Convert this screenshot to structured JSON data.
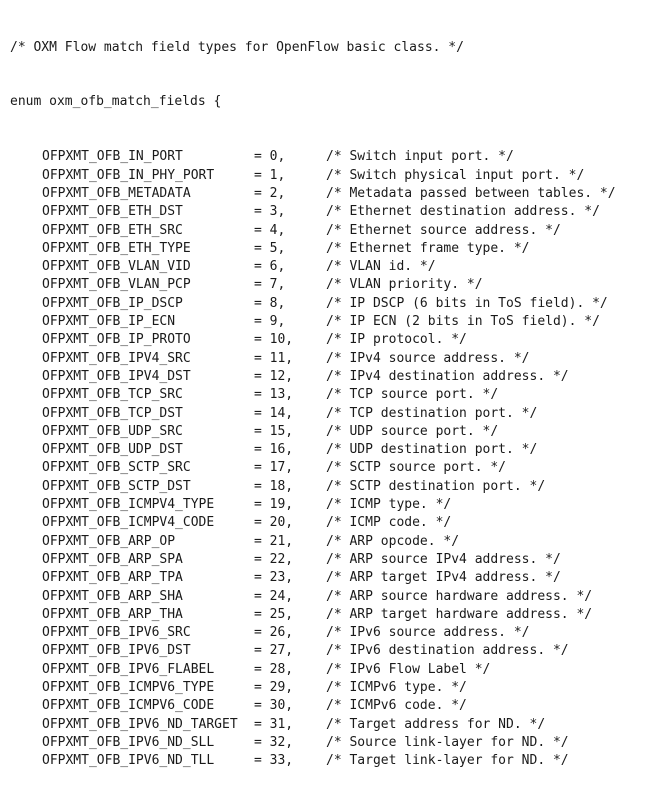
{
  "header_comment": "/* OXM Flow match field types for OpenFlow basic class. */",
  "enum_decl": "enum oxm_ofb_match_fields {",
  "entries": [
    {
      "name": "OFPXMT_OFB_IN_PORT",
      "value": "= 0,",
      "comment": "/* Switch input port. */"
    },
    {
      "name": "OFPXMT_OFB_IN_PHY_PORT",
      "value": "= 1,",
      "comment": "/* Switch physical input port. */"
    },
    {
      "name": "OFPXMT_OFB_METADATA",
      "value": "= 2,",
      "comment": "/* Metadata passed between tables. */"
    },
    {
      "name": "OFPXMT_OFB_ETH_DST",
      "value": "= 3,",
      "comment": "/* Ethernet destination address. */"
    },
    {
      "name": "OFPXMT_OFB_ETH_SRC",
      "value": "= 4,",
      "comment": "/* Ethernet source address. */"
    },
    {
      "name": "OFPXMT_OFB_ETH_TYPE",
      "value": "= 5,",
      "comment": "/* Ethernet frame type. */"
    },
    {
      "name": "OFPXMT_OFB_VLAN_VID",
      "value": "= 6,",
      "comment": "/* VLAN id. */"
    },
    {
      "name": "OFPXMT_OFB_VLAN_PCP",
      "value": "= 7,",
      "comment": "/* VLAN priority. */"
    },
    {
      "name": "OFPXMT_OFB_IP_DSCP",
      "value": "= 8,",
      "comment": "/* IP DSCP (6 bits in ToS field). */"
    },
    {
      "name": "OFPXMT_OFB_IP_ECN",
      "value": "= 9,",
      "comment": "/* IP ECN (2 bits in ToS field). */"
    },
    {
      "name": "OFPXMT_OFB_IP_PROTO",
      "value": "= 10,",
      "comment": "/* IP protocol. */"
    },
    {
      "name": "OFPXMT_OFB_IPV4_SRC",
      "value": "= 11,",
      "comment": "/* IPv4 source address. */"
    },
    {
      "name": "OFPXMT_OFB_IPV4_DST",
      "value": "= 12,",
      "comment": "/* IPv4 destination address. */"
    },
    {
      "name": "OFPXMT_OFB_TCP_SRC",
      "value": "= 13,",
      "comment": "/* TCP source port. */"
    },
    {
      "name": "OFPXMT_OFB_TCP_DST",
      "value": "= 14,",
      "comment": "/* TCP destination port. */"
    },
    {
      "name": "OFPXMT_OFB_UDP_SRC",
      "value": "= 15,",
      "comment": "/* UDP source port. */"
    },
    {
      "name": "OFPXMT_OFB_UDP_DST",
      "value": "= 16,",
      "comment": "/* UDP destination port. */"
    },
    {
      "name": "OFPXMT_OFB_SCTP_SRC",
      "value": "= 17,",
      "comment": "/* SCTP source port. */"
    },
    {
      "name": "OFPXMT_OFB_SCTP_DST",
      "value": "= 18,",
      "comment": "/* SCTP destination port. */"
    },
    {
      "name": "OFPXMT_OFB_ICMPV4_TYPE",
      "value": "= 19,",
      "comment": "/* ICMP type. */"
    },
    {
      "name": "OFPXMT_OFB_ICMPV4_CODE",
      "value": "= 20,",
      "comment": "/* ICMP code. */"
    },
    {
      "name": "OFPXMT_OFB_ARP_OP",
      "value": "= 21,",
      "comment": "/* ARP opcode. */"
    },
    {
      "name": "OFPXMT_OFB_ARP_SPA",
      "value": "= 22,",
      "comment": "/* ARP source IPv4 address. */"
    },
    {
      "name": "OFPXMT_OFB_ARP_TPA",
      "value": "= 23,",
      "comment": "/* ARP target IPv4 address. */"
    },
    {
      "name": "OFPXMT_OFB_ARP_SHA",
      "value": "= 24,",
      "comment": "/* ARP source hardware address. */"
    },
    {
      "name": "OFPXMT_OFB_ARP_THA",
      "value": "= 25,",
      "comment": "/* ARP target hardware address. */"
    },
    {
      "name": "OFPXMT_OFB_IPV6_SRC",
      "value": "= 26,",
      "comment": "/* IPv6 source address. */"
    },
    {
      "name": "OFPXMT_OFB_IPV6_DST",
      "value": "= 27,",
      "comment": "/* IPv6 destination address. */"
    },
    {
      "name": "OFPXMT_OFB_IPV6_FLABEL",
      "value": "= 28,",
      "comment": "/* IPv6 Flow Label */"
    },
    {
      "name": "OFPXMT_OFB_ICMPV6_TYPE",
      "value": "= 29,",
      "comment": "/* ICMPv6 type. */"
    },
    {
      "name": "OFPXMT_OFB_ICMPV6_CODE",
      "value": "= 30,",
      "comment": "/* ICMPv6 code. */"
    },
    {
      "name": "OFPXMT_OFB_IPV6_ND_TARGET",
      "value": "= 31,",
      "comment": "/* Target address for ND. */"
    },
    {
      "name": "OFPXMT_OFB_IPV6_ND_SLL",
      "value": "= 32,",
      "comment": "/* Source link-layer for ND. */"
    },
    {
      "name": "OFPXMT_OFB_IPV6_ND_TLL",
      "value": "= 33,",
      "comment": "/* Target link-layer for ND. */"
    }
  ]
}
